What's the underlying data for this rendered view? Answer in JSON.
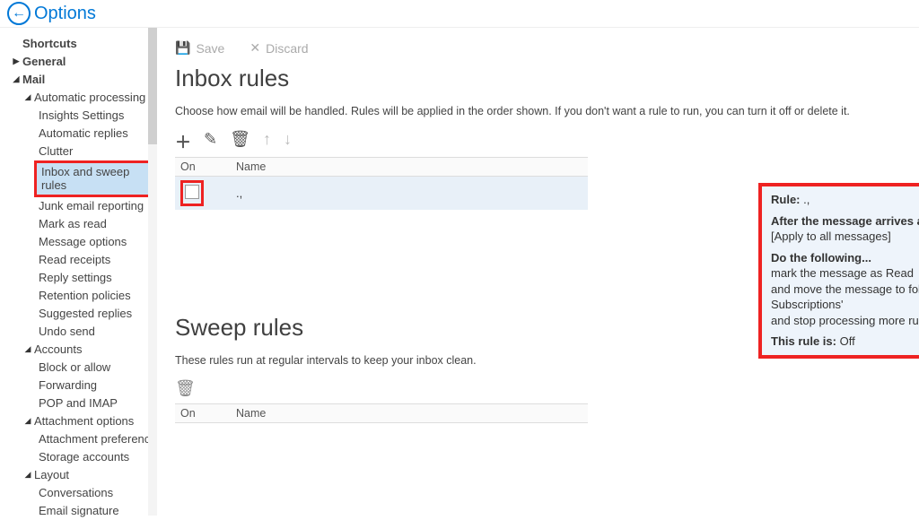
{
  "header": {
    "title": "Options"
  },
  "toolbar": {
    "save": "Save",
    "discard": "Discard"
  },
  "nav": {
    "shortcuts": "Shortcuts",
    "general": "General",
    "mail": "Mail",
    "autoproc": "Automatic processing",
    "autoproc_items": [
      "Insights Settings",
      "Automatic replies",
      "Clutter",
      "Inbox and sweep rules",
      "Junk email reporting",
      "Mark as read",
      "Message options",
      "Read receipts",
      "Reply settings",
      "Retention policies",
      "Suggested replies",
      "Undo send"
    ],
    "accounts": "Accounts",
    "accounts_items": [
      "Block or allow",
      "Forwarding",
      "POP and IMAP"
    ],
    "attach": "Attachment options",
    "attach_items": [
      "Attachment preference",
      "Storage accounts"
    ],
    "layout": "Layout",
    "layout_items": [
      "Conversations",
      "Email signature"
    ]
  },
  "inbox_rules": {
    "heading": "Inbox rules",
    "description": "Choose how email will be handled. Rules will be applied in the order shown. If you don't want a rule to run, you can turn it off or delete it.",
    "columns": {
      "on": "On",
      "name": "Name"
    },
    "rows": [
      {
        "checked": false,
        "name": ".,"
      }
    ]
  },
  "rule_detail": {
    "rule_label": "Rule:",
    "rule_name": ".,",
    "after_label": "After the message arrives and...",
    "condition": "[Apply to all messages]",
    "do_label": "Do the following...",
    "action_lines": [
      "mark the message as Read",
      "and move the message to folder 'RSS Subscriptions'",
      "and stop processing more rules on this message"
    ],
    "status_label": "This rule is:",
    "status_value": "Off"
  },
  "sweep_rules": {
    "heading": "Sweep rules",
    "description": "These rules run at regular intervals to keep your inbox clean.",
    "columns": {
      "on": "On",
      "name": "Name"
    }
  }
}
